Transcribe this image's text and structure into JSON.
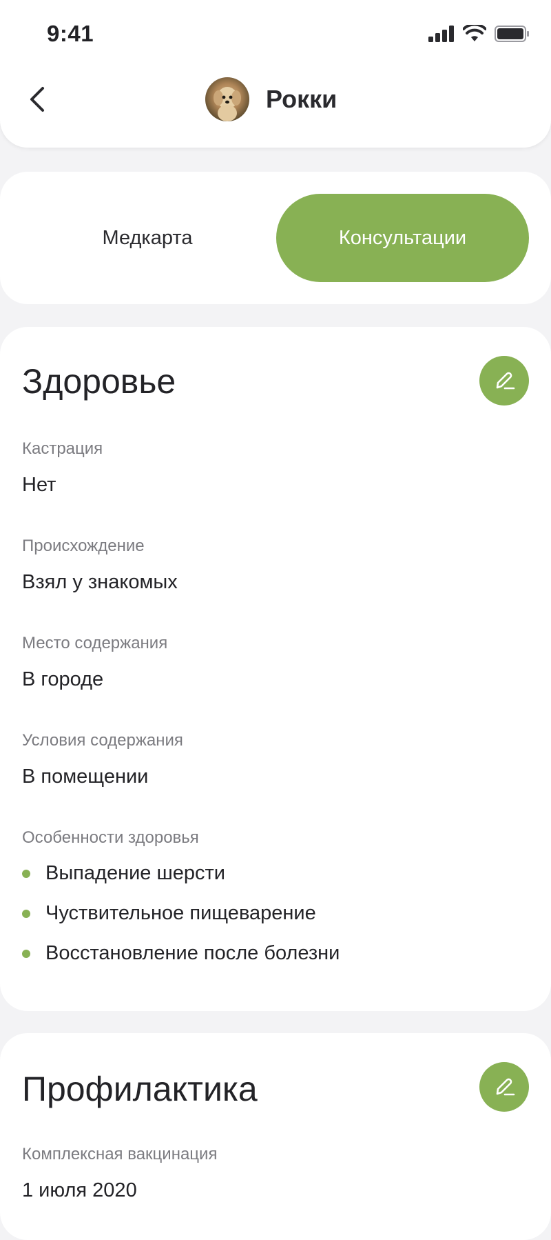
{
  "status_bar": {
    "time": "9:41"
  },
  "header": {
    "pet_name": "Рокки"
  },
  "tabs": [
    {
      "label": "Медкарта",
      "active": false
    },
    {
      "label": "Консультации",
      "active": true
    }
  ],
  "health": {
    "title": "Здоровье",
    "fields": [
      {
        "label": "Кастрация",
        "value": "Нет"
      },
      {
        "label": "Происхождение",
        "value": "Взял у знакомых"
      },
      {
        "label": "Место содержания",
        "value": "В городе"
      },
      {
        "label": "Условия содержания",
        "value": "В помещении"
      }
    ],
    "features_label": "Особенности здоровья",
    "features": [
      "Выпадение шерсти",
      "Чуствительное пищеварение",
      "Восстановление после болезни"
    ]
  },
  "prevention": {
    "title": "Профилактика",
    "fields": [
      {
        "label": "Комплексная вакцинация",
        "value": "1 июля 2020"
      }
    ]
  },
  "colors": {
    "accent": "#88b154",
    "background": "#f3f3f5",
    "card": "#ffffff"
  },
  "icons": [
    "back-chevron-icon",
    "signal-icon",
    "wifi-icon",
    "battery-icon",
    "edit-pencil-icon"
  ]
}
